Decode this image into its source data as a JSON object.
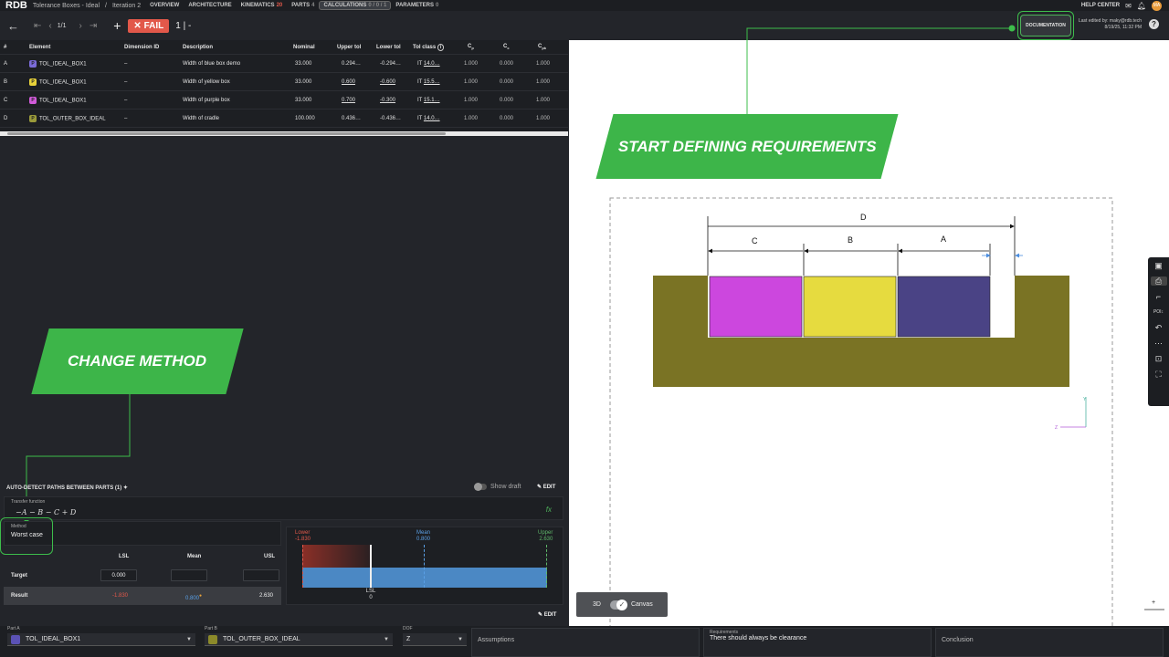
{
  "topnav": {
    "logo": "RDB",
    "project": "Tolerance Boxes - Ideal",
    "separator": "/",
    "iteration": "Iteration 2",
    "items": [
      {
        "label": "OVERVIEW",
        "count": ""
      },
      {
        "label": "ARCHITECTURE",
        "count": ""
      },
      {
        "label": "KINEMATICS",
        "count": "20"
      },
      {
        "label": "PARTS",
        "count": "4"
      },
      {
        "label": "CALCULATIONS",
        "count": "0 / 0 / 1"
      },
      {
        "label": "PARAMETERS",
        "count": "0"
      }
    ],
    "help": "HELP CENTER",
    "avatar": "MA"
  },
  "toolbar": {
    "page": "1/1",
    "fail_label": "FAIL",
    "fail_count": "1 | -"
  },
  "documentation_label": "DOCUMENTATION",
  "last_edited": {
    "line1": "Last edited by: maky@rdb.tech",
    "line2": "8/19/25, 11:32 PM"
  },
  "table": {
    "headers": {
      "num": "#",
      "element": "Element",
      "dim_id": "Dimension ID",
      "description": "Description",
      "nominal": "Nominal",
      "upper": "Upper tol",
      "lower": "Lower tol",
      "tolclass": "Tol class",
      "cp_base": "C",
      "cp_sub": "p",
      "cc_base": "C",
      "cc_sub": "c",
      "cpk_base": "C",
      "cpk_sub": "pk"
    },
    "rows": [
      {
        "num": "A",
        "chip": "P",
        "chip_color": "#7b6cd9",
        "element": "TOL_IDEAL_BOX1",
        "dim_id": "–",
        "description": "Width of blue box demo",
        "nominal": "33.000",
        "upper": "0.294…",
        "lower": "-0.294…",
        "tolclass": "IT 14.0…",
        "cp": "1.000",
        "cc": "0.000",
        "cpk": "1.000"
      },
      {
        "num": "B",
        "chip": "P",
        "chip_color": "#e8d23a",
        "element": "TOL_IDEAL_BOX1",
        "dim_id": "–",
        "description": "Width of yellow box",
        "nominal": "33.000",
        "upper": "0.600",
        "lower": "-0.600",
        "tolclass": "IT 15.5…",
        "cp": "1.000",
        "cc": "0.000",
        "cpk": "1.000"
      },
      {
        "num": "C",
        "chip": "P",
        "chip_color": "#d05ad8",
        "element": "TOL_IDEAL_BOX1",
        "dim_id": "–",
        "description": "Width of purple box",
        "nominal": "33.000",
        "upper": "0.700",
        "lower": "-0.300",
        "tolclass": "IT 15.1…",
        "cp": "1.000",
        "cc": "0.000",
        "cpk": "1.000"
      },
      {
        "num": "D",
        "chip": "P",
        "chip_color": "#9a9a3a",
        "element": "TOL_OUTER_BOX_IDEAL",
        "dim_id": "–",
        "description": "Width of cradle",
        "nominal": "100.000",
        "upper": "0.436…",
        "lower": "-0.436…",
        "tolclass": "IT 14.0…",
        "cp": "1.000",
        "cc": "0.000",
        "cpk": "1.000"
      }
    ]
  },
  "callouts": {
    "requirements": "START DEFINING REQUIREMENTS",
    "method": "CHANGE METHOD"
  },
  "drawing": {
    "label_d": "D",
    "label_c": "C",
    "label_b": "B",
    "label_a": "A",
    "axis_y": "Y",
    "axis_z": "Z",
    "colors": {
      "purple": "#cc47de",
      "yellow": "#e6db3f",
      "blue": "#4a4385",
      "cradle": "#7a7324"
    }
  },
  "view_toggle": {
    "left": "3D",
    "right": "Canvas"
  },
  "paths": {
    "title": "AUTO-DETECT PATHS BETWEEN PARTS (1)",
    "show_draft": "Show draft",
    "edit": "EDIT",
    "transfer_label": "Transfer function",
    "transfer_fn": "−A − B − C + D",
    "method_label": "Method",
    "method_value": "Worst case"
  },
  "results": {
    "col_lsl": "LSL",
    "col_mean": "Mean",
    "col_usl": "USL",
    "row_target": "Target",
    "target_lsl": "0.000",
    "row_result": "Result",
    "result_lsl": "-1.830",
    "result_mean": "0.800",
    "result_usl": "2.630",
    "edit": "EDIT"
  },
  "distribution": {
    "lower_label": "Lower",
    "lower_value": "-1.830",
    "mean_label": "Mean",
    "mean_value": "0.800",
    "upper_label": "Upper",
    "upper_value": "2.630",
    "lsl_label": "LSL",
    "lsl_value": "0"
  },
  "bottom": {
    "part_a_label": "Part A",
    "part_a_value": "TOL_IDEAL_BOX1",
    "part_b_label": "Part B",
    "part_b_value": "TOL_OUTER_BOX_IDEAL",
    "dof_label": "DOF",
    "dof_value": "Z",
    "assumptions": "Assumptions",
    "requirements_label": "Requirements",
    "requirements_value": "There should always be clearance",
    "conclusion": "Conclusion"
  }
}
